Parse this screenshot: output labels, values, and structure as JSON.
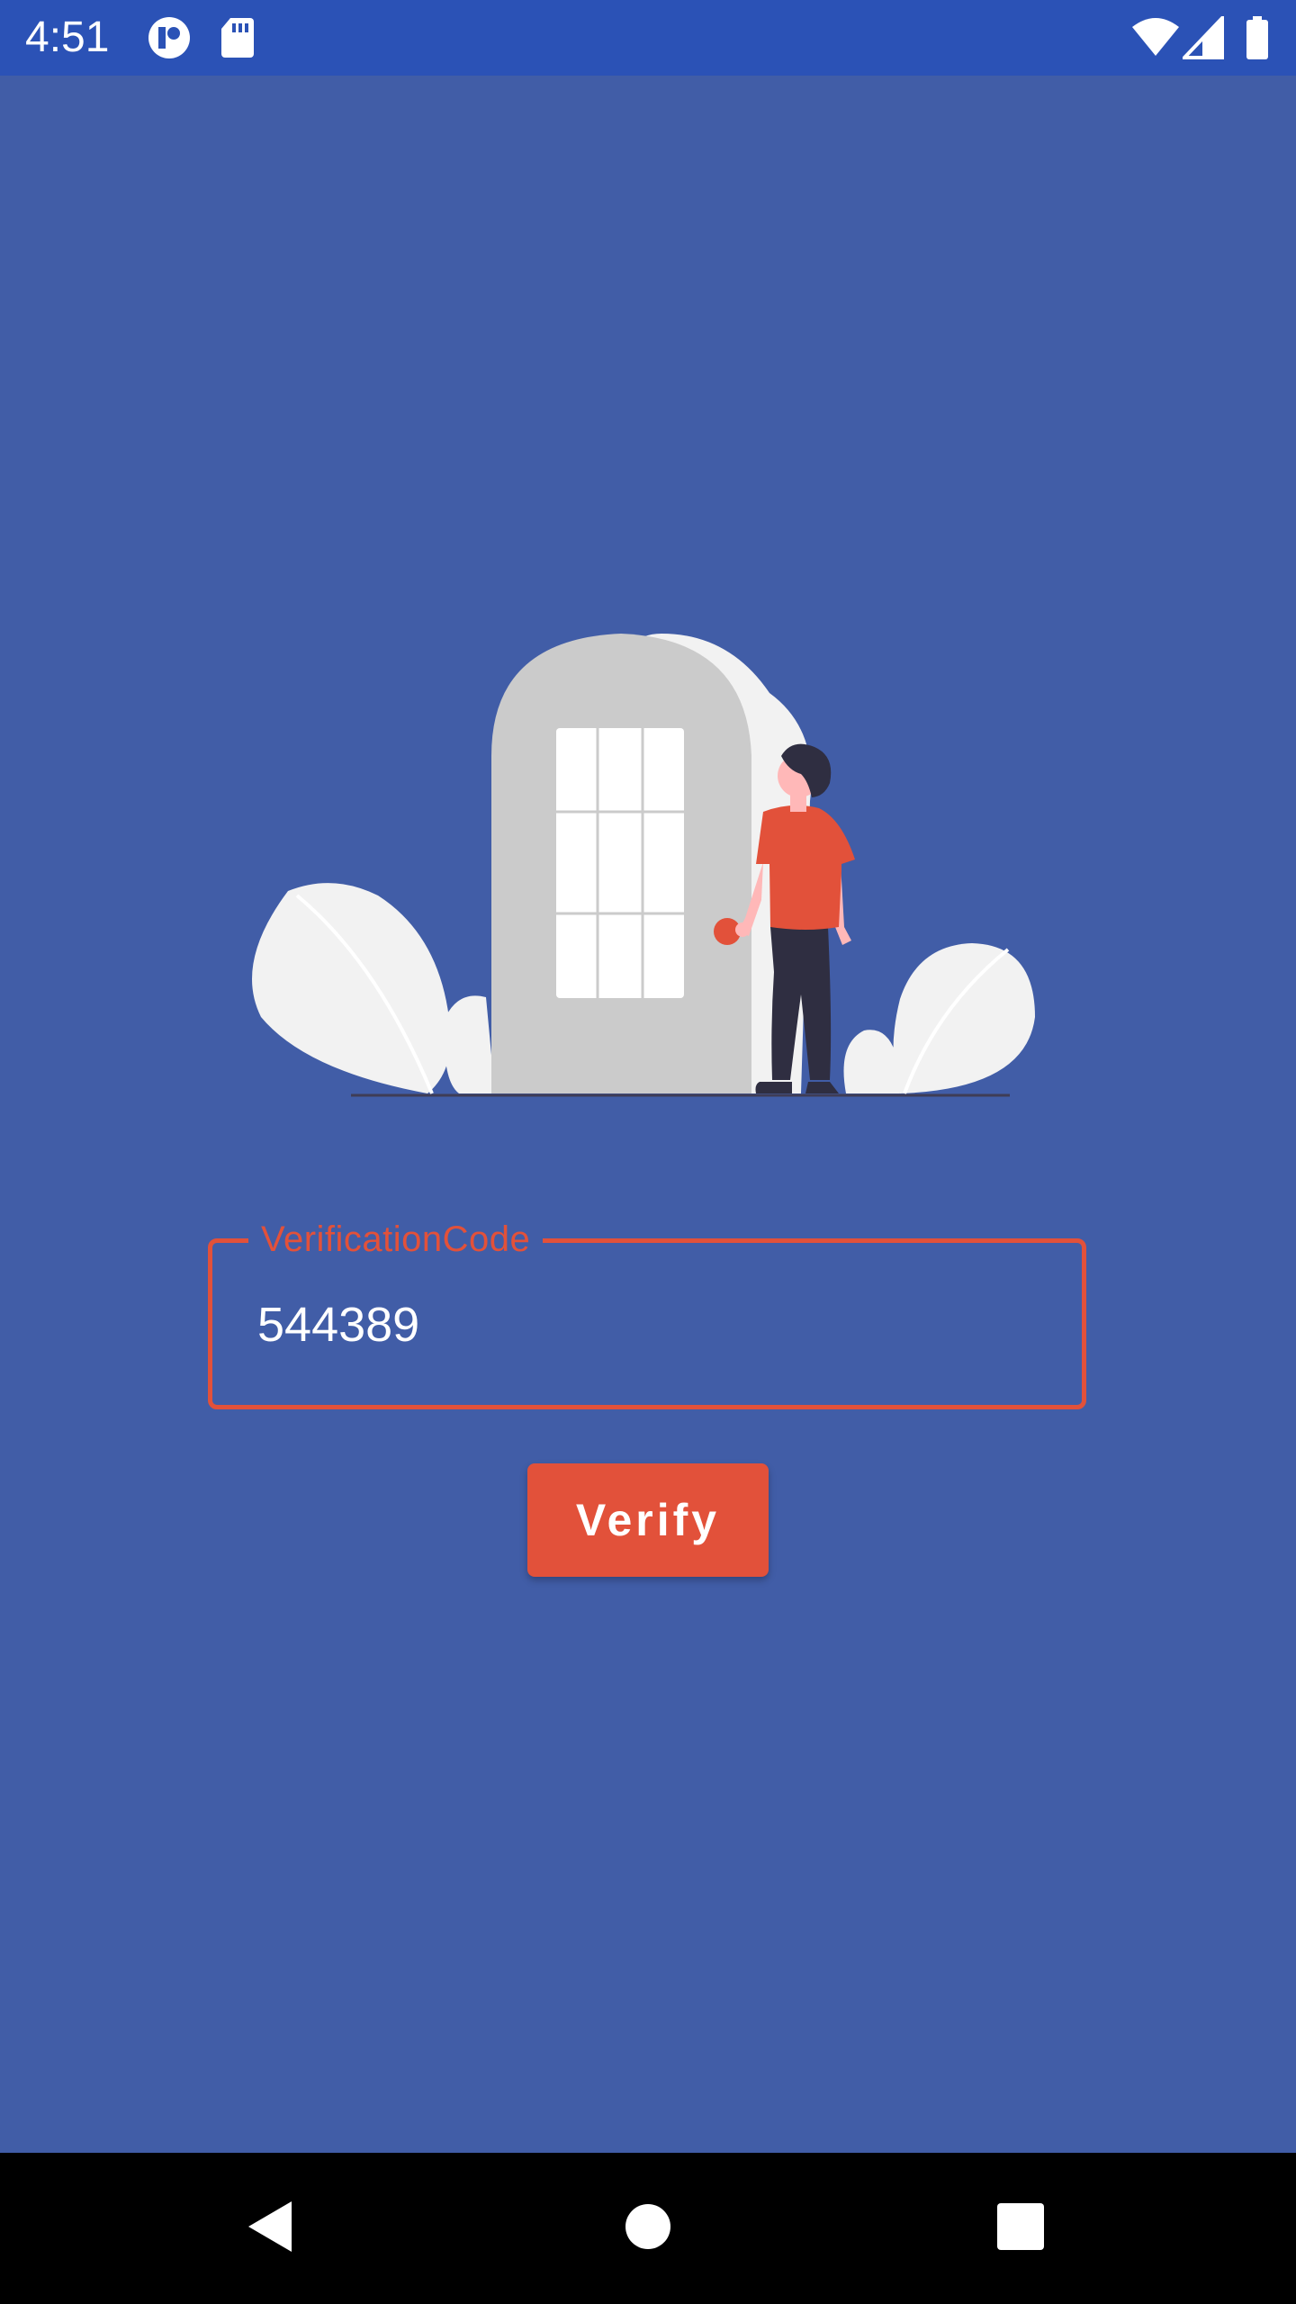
{
  "status_bar": {
    "time": "4:51",
    "icons_left": [
      "app-notification-icon",
      "sd-card-icon"
    ],
    "icons_right": [
      "wifi-icon",
      "cellular-signal-icon",
      "battery-icon"
    ],
    "background": "#2b52b6"
  },
  "illustration": {
    "description_icon": "door-and-person-illustration"
  },
  "verification": {
    "label": "VerificationCode",
    "value": "544389",
    "accent_color": "#e2513a"
  },
  "verify_button": {
    "label": "Verify"
  },
  "nav_bar": {
    "items": [
      "back-icon",
      "home-icon",
      "recents-icon"
    ]
  },
  "colors": {
    "background": "#415da7",
    "accent": "#e2513a",
    "status_bar": "#2b52b6",
    "nav_bar": "#000000"
  }
}
